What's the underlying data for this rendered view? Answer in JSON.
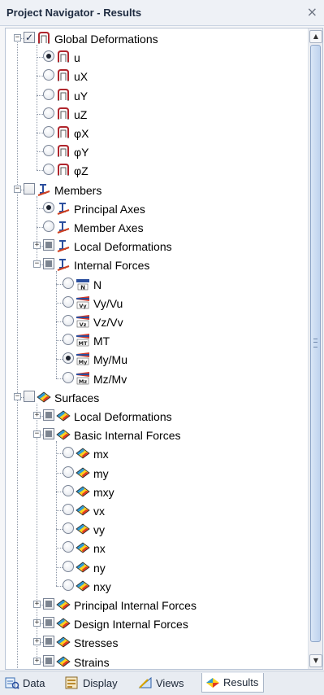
{
  "panel": {
    "title": "Project Navigator - Results",
    "close_glyph": "×"
  },
  "tree": [
    {
      "level": 0,
      "expander": "minus",
      "ctl": "checkbox",
      "state": "checked",
      "icon": "deformation-icon",
      "label": "Global Deformations"
    },
    {
      "level": 1,
      "ctl": "radio",
      "state": "on",
      "icon": "deformation-icon",
      "label": "u"
    },
    {
      "level": 1,
      "ctl": "radio",
      "state": "off",
      "icon": "deformation-icon",
      "label": "uX"
    },
    {
      "level": 1,
      "ctl": "radio",
      "state": "off",
      "icon": "deformation-icon",
      "label": "uY"
    },
    {
      "level": 1,
      "ctl": "radio",
      "state": "off",
      "icon": "deformation-icon",
      "label": "uZ"
    },
    {
      "level": 1,
      "ctl": "radio",
      "state": "off",
      "icon": "deformation-icon",
      "label": "φX"
    },
    {
      "level": 1,
      "ctl": "radio",
      "state": "off",
      "icon": "deformation-icon",
      "label": "φY"
    },
    {
      "level": 1,
      "ctl": "radio",
      "state": "off",
      "icon": "deformation-icon",
      "label": "φZ"
    },
    {
      "level": 0,
      "expander": "minus",
      "ctl": "checkbox",
      "state": "unchecked",
      "icon": "member-icon",
      "label": "Members"
    },
    {
      "level": 1,
      "ctl": "radio",
      "state": "on",
      "icon": "member-icon",
      "label": "Principal Axes"
    },
    {
      "level": 1,
      "ctl": "radio",
      "state": "off",
      "icon": "member-icon",
      "label": "Member Axes"
    },
    {
      "level": 1,
      "expander": "plus",
      "ctl": "checkbox",
      "state": "indeterminate",
      "icon": "member-icon",
      "label": "Local Deformations"
    },
    {
      "level": 1,
      "expander": "minus",
      "ctl": "checkbox",
      "state": "indeterminate",
      "icon": "member-icon",
      "label": "Internal Forces"
    },
    {
      "level": 2,
      "ctl": "radio",
      "state": "off",
      "icon": "force-n-icon",
      "label": "N"
    },
    {
      "level": 2,
      "ctl": "radio",
      "state": "off",
      "icon": "force-vy-icon",
      "label": "Vy/Vu"
    },
    {
      "level": 2,
      "ctl": "radio",
      "state": "off",
      "icon": "force-vz-icon",
      "label": "Vz/Vv"
    },
    {
      "level": 2,
      "ctl": "radio",
      "state": "off",
      "icon": "moment-mt-icon",
      "label": "MT"
    },
    {
      "level": 2,
      "ctl": "radio",
      "state": "on",
      "icon": "moment-my-icon",
      "label": "My/Mu"
    },
    {
      "level": 2,
      "ctl": "radio",
      "state": "off",
      "icon": "moment-mz-icon",
      "label": "Mz/Mv"
    },
    {
      "level": 0,
      "expander": "minus",
      "ctl": "checkbox",
      "state": "unchecked",
      "icon": "surface-icon",
      "label": "Surfaces"
    },
    {
      "level": 1,
      "expander": "plus",
      "ctl": "checkbox",
      "state": "indeterminate",
      "icon": "surface-icon",
      "label": "Local Deformations"
    },
    {
      "level": 1,
      "expander": "minus",
      "ctl": "checkbox",
      "state": "indeterminate",
      "icon": "surface-icon",
      "label": "Basic Internal Forces"
    },
    {
      "level": 2,
      "ctl": "radio",
      "state": "off",
      "icon": "surface-icon",
      "label": "mx"
    },
    {
      "level": 2,
      "ctl": "radio",
      "state": "off",
      "icon": "surface-icon",
      "label": "my"
    },
    {
      "level": 2,
      "ctl": "radio",
      "state": "off",
      "icon": "surface-icon",
      "label": "mxy"
    },
    {
      "level": 2,
      "ctl": "radio",
      "state": "off",
      "icon": "surface-icon",
      "label": "vx"
    },
    {
      "level": 2,
      "ctl": "radio",
      "state": "off",
      "icon": "surface-icon",
      "label": "vy"
    },
    {
      "level": 2,
      "ctl": "radio",
      "state": "off",
      "icon": "surface-icon",
      "label": "nx"
    },
    {
      "level": 2,
      "ctl": "radio",
      "state": "off",
      "icon": "surface-icon",
      "label": "ny"
    },
    {
      "level": 2,
      "ctl": "radio",
      "state": "off",
      "icon": "surface-icon",
      "label": "nxy"
    },
    {
      "level": 1,
      "expander": "plus",
      "ctl": "checkbox",
      "state": "indeterminate",
      "icon": "surface-icon",
      "label": "Principal Internal Forces"
    },
    {
      "level": 1,
      "expander": "plus",
      "ctl": "checkbox",
      "state": "indeterminate",
      "icon": "surface-icon",
      "label": "Design Internal Forces"
    },
    {
      "level": 1,
      "expander": "plus",
      "ctl": "checkbox",
      "state": "indeterminate",
      "icon": "surface-icon",
      "label": "Stresses"
    },
    {
      "level": 1,
      "expander": "plus",
      "ctl": "checkbox",
      "state": "indeterminate",
      "icon": "surface-icon",
      "label": "Strains"
    }
  ],
  "tabs": [
    {
      "label": "Data",
      "icon": "data-icon",
      "active": false
    },
    {
      "label": "Display",
      "icon": "display-icon",
      "active": false
    },
    {
      "label": "Views",
      "icon": "views-icon",
      "active": false
    },
    {
      "label": "Results",
      "icon": "results-icon",
      "active": true
    }
  ],
  "colors": {
    "selection": "#d7e4f6",
    "deformation": "#b0262d",
    "member": "#2b4f9e",
    "surface_top": "#2e9bd6",
    "surface_mid": "#ffd21f",
    "surface_bot": "#e23b22"
  }
}
